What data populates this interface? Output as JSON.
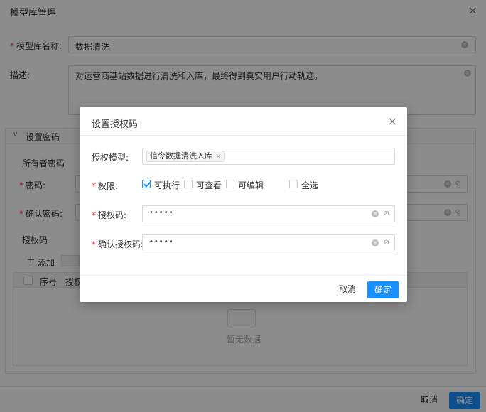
{
  "background": {
    "title": "模型库管理",
    "close_icon": "×",
    "name_label": "模型库名称:",
    "name_value": "数据清洗",
    "desc_label": "描述:",
    "desc_value": "对运营商基站数据进行清洗和入库，最终得到真实用户行动轨迹。",
    "section_title": "设置密码",
    "owner_pwd_label": "所有者密码",
    "pwd_label": "密码:",
    "confirm_pwd_label": "确认密码:",
    "auth_code_label": "授权码",
    "add_label": "添加",
    "col_index": "序号",
    "col_auth": "授权",
    "empty_text": "暂无数据",
    "cancel": "取消",
    "ok": "确定"
  },
  "modal": {
    "title": "设置授权码",
    "close_icon": "×",
    "auth_model_label": "授权模型:",
    "auth_model_tag": "信令数据清洗入库",
    "permission_label": "权限:",
    "permissions": [
      {
        "label": "可执行",
        "checked": true
      },
      {
        "label": "可查看",
        "checked": false
      },
      {
        "label": "可编辑",
        "checked": false
      },
      {
        "label": "全选",
        "checked": false
      }
    ],
    "auth_code_label": "授权码:",
    "auth_code_value": "•••••",
    "confirm_auth_code_label": "确认授权码:",
    "confirm_auth_code_value": "•••••",
    "cancel": "取消",
    "ok": "确定"
  },
  "colors": {
    "primary": "#1890ff",
    "required": "#f5222d",
    "mask": "rgba(0,0,0,0.45)"
  }
}
